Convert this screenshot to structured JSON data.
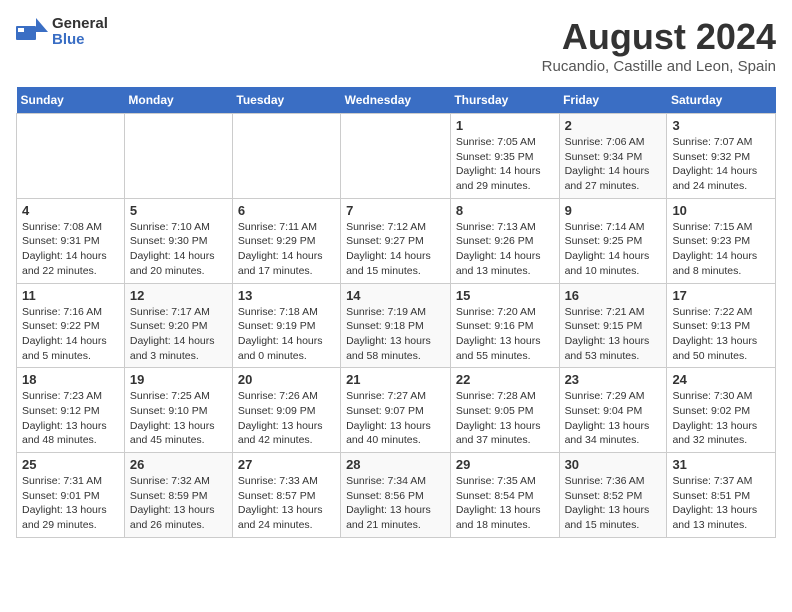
{
  "header": {
    "logo": {
      "general": "General",
      "blue": "Blue"
    },
    "title": "August 2024",
    "subtitle": "Rucandio, Castille and Leon, Spain"
  },
  "calendar": {
    "days_of_week": [
      "Sunday",
      "Monday",
      "Tuesday",
      "Wednesday",
      "Thursday",
      "Friday",
      "Saturday"
    ],
    "weeks": [
      [
        {
          "day": "",
          "detail": ""
        },
        {
          "day": "",
          "detail": ""
        },
        {
          "day": "",
          "detail": ""
        },
        {
          "day": "",
          "detail": ""
        },
        {
          "day": "1",
          "detail": "Sunrise: 7:05 AM\nSunset: 9:35 PM\nDaylight: 14 hours\nand 29 minutes."
        },
        {
          "day": "2",
          "detail": "Sunrise: 7:06 AM\nSunset: 9:34 PM\nDaylight: 14 hours\nand 27 minutes."
        },
        {
          "day": "3",
          "detail": "Sunrise: 7:07 AM\nSunset: 9:32 PM\nDaylight: 14 hours\nand 24 minutes."
        }
      ],
      [
        {
          "day": "4",
          "detail": "Sunrise: 7:08 AM\nSunset: 9:31 PM\nDaylight: 14 hours\nand 22 minutes."
        },
        {
          "day": "5",
          "detail": "Sunrise: 7:10 AM\nSunset: 9:30 PM\nDaylight: 14 hours\nand 20 minutes."
        },
        {
          "day": "6",
          "detail": "Sunrise: 7:11 AM\nSunset: 9:29 PM\nDaylight: 14 hours\nand 17 minutes."
        },
        {
          "day": "7",
          "detail": "Sunrise: 7:12 AM\nSunset: 9:27 PM\nDaylight: 14 hours\nand 15 minutes."
        },
        {
          "day": "8",
          "detail": "Sunrise: 7:13 AM\nSunset: 9:26 PM\nDaylight: 14 hours\nand 13 minutes."
        },
        {
          "day": "9",
          "detail": "Sunrise: 7:14 AM\nSunset: 9:25 PM\nDaylight: 14 hours\nand 10 minutes."
        },
        {
          "day": "10",
          "detail": "Sunrise: 7:15 AM\nSunset: 9:23 PM\nDaylight: 14 hours\nand 8 minutes."
        }
      ],
      [
        {
          "day": "11",
          "detail": "Sunrise: 7:16 AM\nSunset: 9:22 PM\nDaylight: 14 hours\nand 5 minutes."
        },
        {
          "day": "12",
          "detail": "Sunrise: 7:17 AM\nSunset: 9:20 PM\nDaylight: 14 hours\nand 3 minutes."
        },
        {
          "day": "13",
          "detail": "Sunrise: 7:18 AM\nSunset: 9:19 PM\nDaylight: 14 hours\nand 0 minutes."
        },
        {
          "day": "14",
          "detail": "Sunrise: 7:19 AM\nSunset: 9:18 PM\nDaylight: 13 hours\nand 58 minutes."
        },
        {
          "day": "15",
          "detail": "Sunrise: 7:20 AM\nSunset: 9:16 PM\nDaylight: 13 hours\nand 55 minutes."
        },
        {
          "day": "16",
          "detail": "Sunrise: 7:21 AM\nSunset: 9:15 PM\nDaylight: 13 hours\nand 53 minutes."
        },
        {
          "day": "17",
          "detail": "Sunrise: 7:22 AM\nSunset: 9:13 PM\nDaylight: 13 hours\nand 50 minutes."
        }
      ],
      [
        {
          "day": "18",
          "detail": "Sunrise: 7:23 AM\nSunset: 9:12 PM\nDaylight: 13 hours\nand 48 minutes."
        },
        {
          "day": "19",
          "detail": "Sunrise: 7:25 AM\nSunset: 9:10 PM\nDaylight: 13 hours\nand 45 minutes."
        },
        {
          "day": "20",
          "detail": "Sunrise: 7:26 AM\nSunset: 9:09 PM\nDaylight: 13 hours\nand 42 minutes."
        },
        {
          "day": "21",
          "detail": "Sunrise: 7:27 AM\nSunset: 9:07 PM\nDaylight: 13 hours\nand 40 minutes."
        },
        {
          "day": "22",
          "detail": "Sunrise: 7:28 AM\nSunset: 9:05 PM\nDaylight: 13 hours\nand 37 minutes."
        },
        {
          "day": "23",
          "detail": "Sunrise: 7:29 AM\nSunset: 9:04 PM\nDaylight: 13 hours\nand 34 minutes."
        },
        {
          "day": "24",
          "detail": "Sunrise: 7:30 AM\nSunset: 9:02 PM\nDaylight: 13 hours\nand 32 minutes."
        }
      ],
      [
        {
          "day": "25",
          "detail": "Sunrise: 7:31 AM\nSunset: 9:01 PM\nDaylight: 13 hours\nand 29 minutes."
        },
        {
          "day": "26",
          "detail": "Sunrise: 7:32 AM\nSunset: 8:59 PM\nDaylight: 13 hours\nand 26 minutes."
        },
        {
          "day": "27",
          "detail": "Sunrise: 7:33 AM\nSunset: 8:57 PM\nDaylight: 13 hours\nand 24 minutes."
        },
        {
          "day": "28",
          "detail": "Sunrise: 7:34 AM\nSunset: 8:56 PM\nDaylight: 13 hours\nand 21 minutes."
        },
        {
          "day": "29",
          "detail": "Sunrise: 7:35 AM\nSunset: 8:54 PM\nDaylight: 13 hours\nand 18 minutes."
        },
        {
          "day": "30",
          "detail": "Sunrise: 7:36 AM\nSunset: 8:52 PM\nDaylight: 13 hours\nand 15 minutes."
        },
        {
          "day": "31",
          "detail": "Sunrise: 7:37 AM\nSunset: 8:51 PM\nDaylight: 13 hours\nand 13 minutes."
        }
      ]
    ]
  }
}
